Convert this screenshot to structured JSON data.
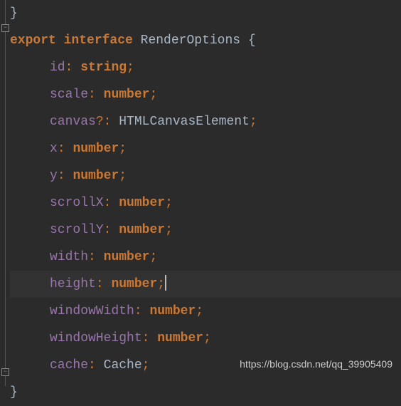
{
  "code": {
    "line0_brace": "}",
    "keyword_export": "export",
    "keyword_interface": "interface",
    "interface_name": "RenderOptions",
    "open_brace": "{",
    "close_brace": "}",
    "props": {
      "id": {
        "name": "id",
        "type": "string",
        "optional": false
      },
      "scale": {
        "name": "scale",
        "type": "number",
        "optional": false
      },
      "canvas": {
        "name": "canvas",
        "type": "HTMLCanvasElement",
        "optional": true
      },
      "x": {
        "name": "x",
        "type": "number",
        "optional": false
      },
      "y": {
        "name": "y",
        "type": "number",
        "optional": false
      },
      "scrollX": {
        "name": "scrollX",
        "type": "number",
        "optional": false
      },
      "scrollY": {
        "name": "scrollY",
        "type": "number",
        "optional": false
      },
      "width": {
        "name": "width",
        "type": "number",
        "optional": false
      },
      "height": {
        "name": "height",
        "type": "number",
        "optional": false
      },
      "windowWidth": {
        "name": "windowWidth",
        "type": "number",
        "optional": false
      },
      "windowHeight": {
        "name": "windowHeight",
        "type": "number",
        "optional": false
      },
      "cache": {
        "name": "cache",
        "type": "Cache",
        "optional": false
      }
    }
  },
  "watermark": "https://blog.csdn.net/qq_39905409"
}
